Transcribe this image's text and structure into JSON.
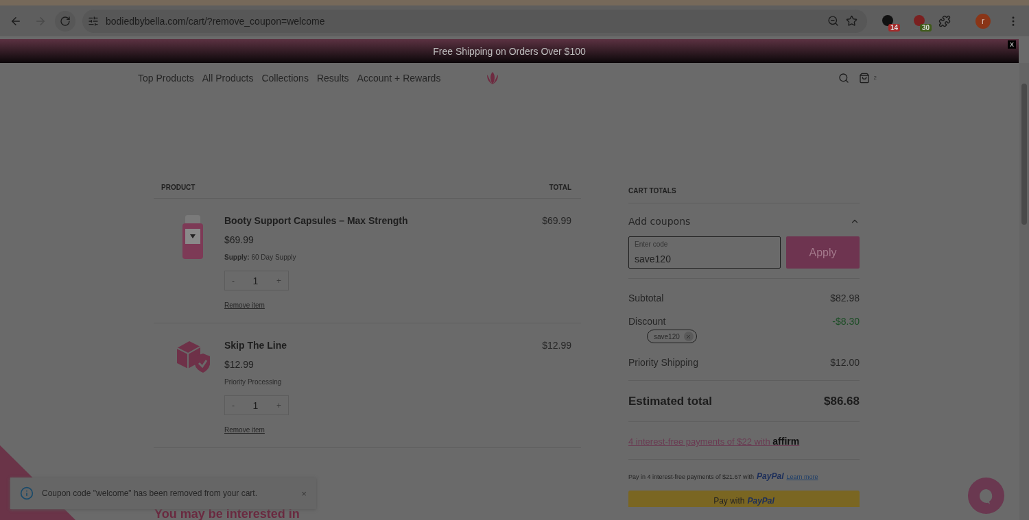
{
  "browser": {
    "url": "bodiedbybella.com/cart/?remove_coupon=welcome",
    "extensions": [
      {
        "badge": "14",
        "color": "#a32a2a"
      },
      {
        "badge": "30",
        "color": "#3f5a1a"
      }
    ],
    "avatar": "r"
  },
  "banner": {
    "text": "Free Shipping on Orders Over $100",
    "close": "X"
  },
  "nav": {
    "links": [
      "Top Products",
      "All Products",
      "Collections",
      "Results",
      "Account + Rewards"
    ],
    "cart_count": "2"
  },
  "cart": {
    "columns": [
      "PRODUCT",
      "TOTAL"
    ],
    "items": [
      {
        "kind": "bottle",
        "name": "Booty Support Capsules – Max Strength",
        "price": "$69.99",
        "option": "**Supply:** 60 Day Supply",
        "minus": "-",
        "quantity": "1",
        "plus": "+",
        "remove": "Remove item",
        "total": "$69.99"
      },
      {
        "kind": "box",
        "name": "Skip The Line",
        "price": "$12.99",
        "option": "Priority Processing",
        "minus": "-",
        "quantity": "1",
        "plus": "+",
        "remove": "Remove item",
        "total": "$12.99"
      }
    ]
  },
  "totals": {
    "heading": "CART TOTALS",
    "coupons": {
      "label": "Add coupons",
      "expanded": true,
      "field_label": "Enter code",
      "value": "save120",
      "apply": "Apply"
    },
    "subtotal": {
      "label": "Subtotal",
      "value": "$82.98"
    },
    "discount": {
      "label": "Discount",
      "value": "-$8.30",
      "coupon": "save120"
    },
    "shipping": {
      "label": "Priority Shipping",
      "value": "$12.00"
    },
    "estimated": {
      "label": "Estimated total",
      "value": "$86.68"
    },
    "affirm": {
      "text": "4 interest-free payments of $22 with",
      "logo": "affirm"
    },
    "paypal": {
      "text": "Pay in 4 interest-free payments of $21.67 with",
      "logo": "PayPal",
      "link": "Learn more"
    },
    "paypal_button": {
      "text": "Pay with",
      "logo": "PayPal"
    }
  },
  "toast": {
    "text": "Coupon code \"welcome\" has been removed from your cart.",
    "close": "×"
  },
  "related_heading": "You may be interested in"
}
